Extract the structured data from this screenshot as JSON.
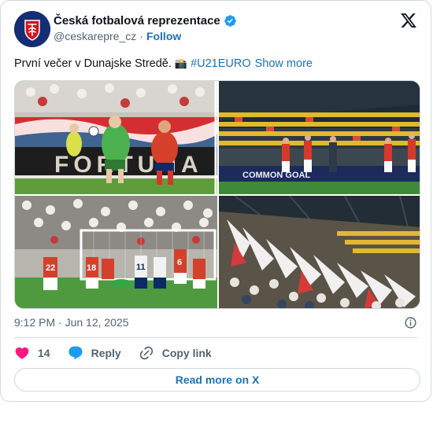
{
  "account": {
    "name": "Česká fotbalová reprezentace",
    "handle": "@ceskarepre_cz",
    "separator": "·",
    "follow_label": "Follow"
  },
  "tweet": {
    "text": "První večer v Dunajske Stredě.",
    "emoji": "📸",
    "hashtag": "#U21EURO",
    "show_more": "Show more"
  },
  "meta": {
    "timestamp": "9:12 PM · Jun 12, 2025"
  },
  "actions": {
    "likes": "14",
    "reply_label": "Reply",
    "copy_label": "Copy link"
  },
  "read_more": "Read more on X",
  "icons": [
    "team-crest-icon",
    "verified-icon",
    "x-logo-icon",
    "info-icon",
    "heart-icon",
    "reply-bubble-icon",
    "link-icon"
  ],
  "photo_overlays": {
    "board_text": "FORTUNA",
    "ad_text": "COMMON GOAL",
    "player_numbers": [
      "22",
      "18",
      "11",
      "6"
    ]
  },
  "colors": {
    "link": "#1d72b8",
    "heart": "#f91880",
    "verified": "#1d9bf0",
    "border": "#cfd9de"
  }
}
